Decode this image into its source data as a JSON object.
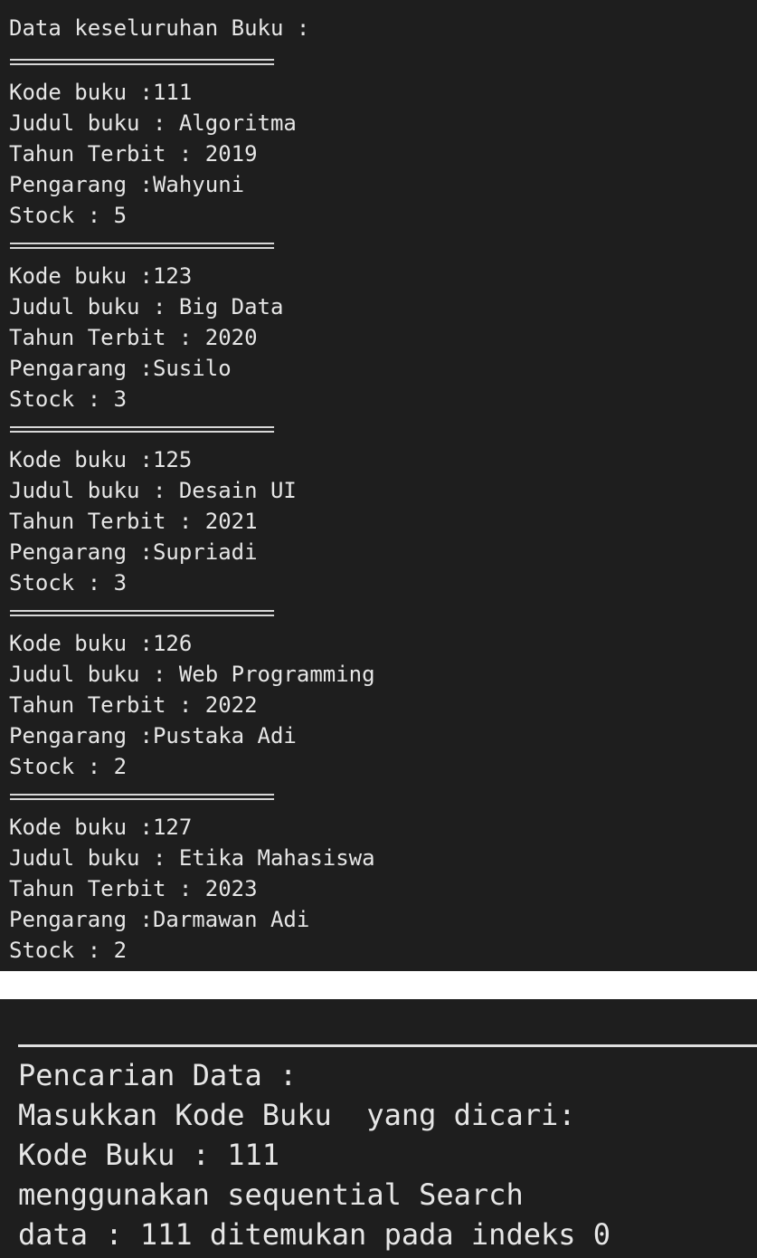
{
  "terminal1": {
    "title": "Data keseluruhan Buku :",
    "separator": "=========================",
    "books": [
      {
        "kode": "Kode buku :111",
        "judul": "Judul buku : Algoritma",
        "tahun": "Tahun Terbit : 2019",
        "pengarang": "Pengarang :Wahyuni",
        "stock": "Stock : 5"
      },
      {
        "kode": "Kode buku :123",
        "judul": "Judul buku : Big Data",
        "tahun": "Tahun Terbit : 2020",
        "pengarang": "Pengarang :Susilo",
        "stock": "Stock : 3"
      },
      {
        "kode": "Kode buku :125",
        "judul": "Judul buku : Desain UI",
        "tahun": "Tahun Terbit : 2021",
        "pengarang": "Pengarang :Supriadi",
        "stock": "Stock : 3"
      },
      {
        "kode": "Kode buku :126",
        "judul": "Judul buku : Web Programming",
        "tahun": "Tahun Terbit : 2022",
        "pengarang": "Pengarang :Pustaka Adi",
        "stock": "Stock : 2"
      },
      {
        "kode": "Kode buku :127",
        "judul": "Judul buku : Etika Mahasiswa",
        "tahun": "Tahun Terbit : 2023",
        "pengarang": "Pengarang :Darmawan Adi",
        "stock": "Stock : 2"
      }
    ]
  },
  "terminal2": {
    "lines": [
      "Pencarian Data :",
      "Masukkan Kode Buku  yang dicari:",
      "Kode Buku : 111",
      "menggunakan sequential Search",
      "data : 111 ditemukan pada indeks 0"
    ]
  },
  "colors": {
    "terminal_bg": "#1e1e1e",
    "text": "#e6e6e6"
  }
}
